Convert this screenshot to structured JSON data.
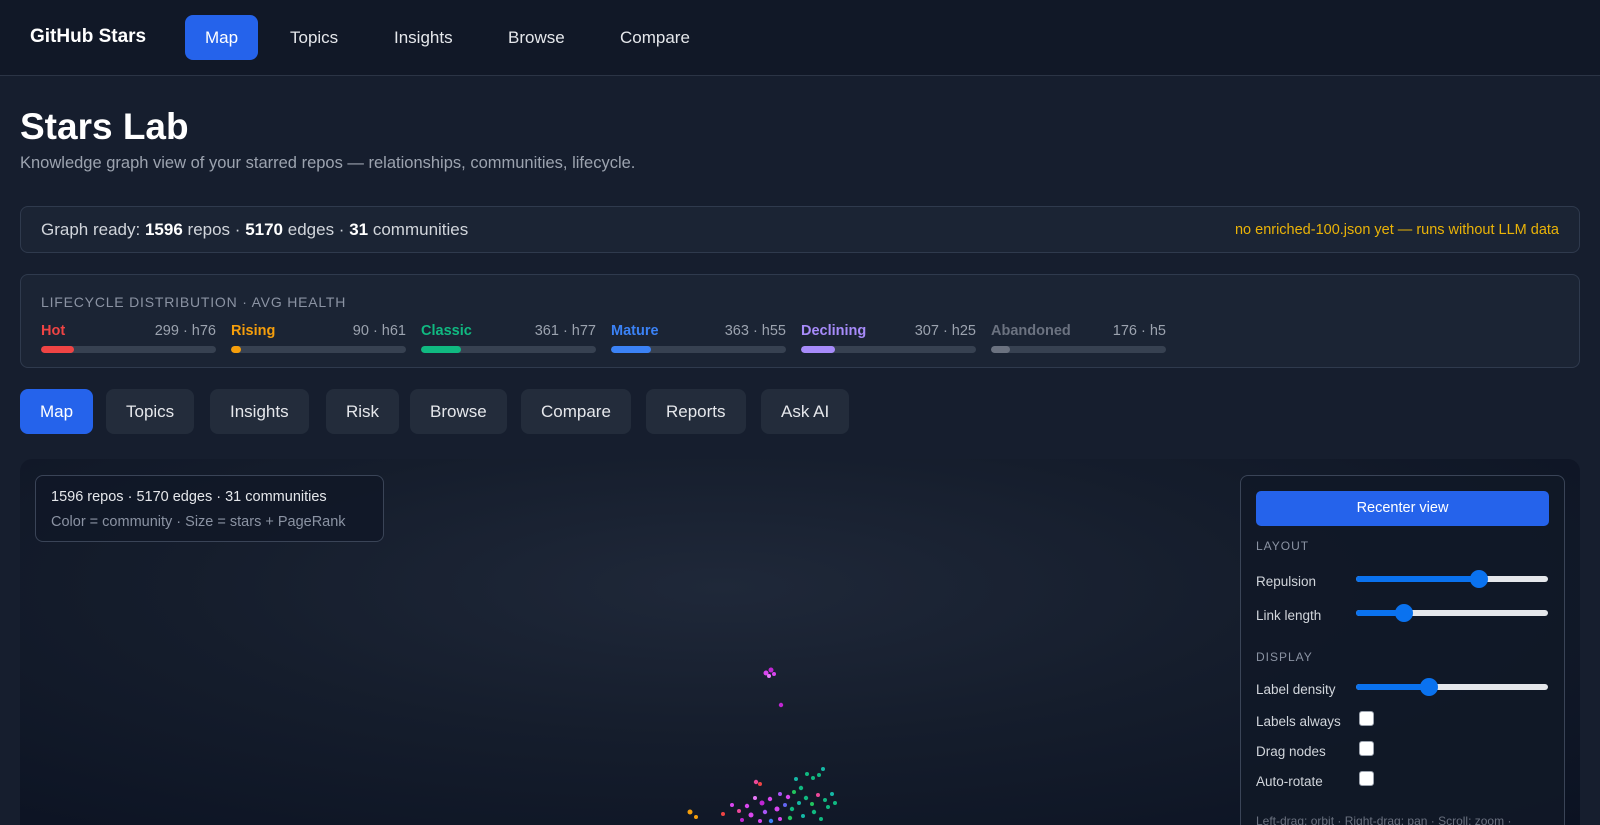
{
  "topnav": {
    "brand": "GitHub Stars",
    "links": [
      {
        "label": "Map",
        "active": true
      },
      {
        "label": "Topics",
        "active": false
      },
      {
        "label": "Insights",
        "active": false
      },
      {
        "label": "Browse",
        "active": false
      },
      {
        "label": "Compare",
        "active": false
      }
    ]
  },
  "page": {
    "title": "Stars Lab",
    "subtitle": "Knowledge graph view of your starred repos — relationships, communities, lifecycle."
  },
  "status": {
    "prefix": "Graph ready:",
    "repos": "1596",
    "repos_label": "repos ·",
    "edges": "5170",
    "edges_label": "edges ·",
    "communities": "31",
    "communities_label": "communities",
    "warning": "no enriched-100.json yet — runs without LLM data",
    "warning_color": "#eab308"
  },
  "lifecycle": {
    "heading": "LIFECYCLE DISTRIBUTION · AVG HEALTH",
    "items": [
      {
        "name": "Hot",
        "value": "299 · h76",
        "color": "#ef4444",
        "fraction": 0.187
      },
      {
        "name": "Rising",
        "value": "90 · h61",
        "color": "#f59e0b",
        "fraction": 0.056
      },
      {
        "name": "Classic",
        "value": "361 · h77",
        "color": "#10b981",
        "fraction": 0.226
      },
      {
        "name": "Mature",
        "value": "363 · h55",
        "color": "#3b82f6",
        "fraction": 0.227
      },
      {
        "name": "Declining",
        "value": "307 · h25",
        "color": "#a78bfa",
        "fraction": 0.192
      },
      {
        "name": "Abandoned",
        "value": "176 · h5",
        "color": "#6b7280",
        "fraction": 0.11
      }
    ]
  },
  "tabs": [
    {
      "label": "Map",
      "active": true
    },
    {
      "label": "Topics",
      "active": false
    },
    {
      "label": "Insights",
      "active": false
    },
    {
      "label": "Risk",
      "active": false
    },
    {
      "label": "Browse",
      "active": false
    },
    {
      "label": "Compare",
      "active": false
    },
    {
      "label": "Reports",
      "active": false
    },
    {
      "label": "Ask AI",
      "active": false
    }
  ],
  "graph_info": {
    "line1": "1596 repos · 5170 edges · 31 communities",
    "line2": "Color = community · Size = stars + PageRank"
  },
  "controls": {
    "recenter_label": "Recenter view",
    "layout_heading": "LAYOUT",
    "repulsion_label": "Repulsion",
    "repulsion_value": 0.64,
    "link_length_label": "Link length",
    "link_length_value": 0.25,
    "display_heading": "DISPLAY",
    "label_density_label": "Label density",
    "label_density_value": 0.38,
    "labels_always_label": "Labels always",
    "labels_always_checked": false,
    "drag_nodes_label": "Drag nodes",
    "drag_nodes_checked": false,
    "auto_rotate_label": "Auto-rotate",
    "auto_rotate_checked": false,
    "hint": "Left-drag: orbit · Right-drag: pan · Scroll: zoom ·"
  }
}
